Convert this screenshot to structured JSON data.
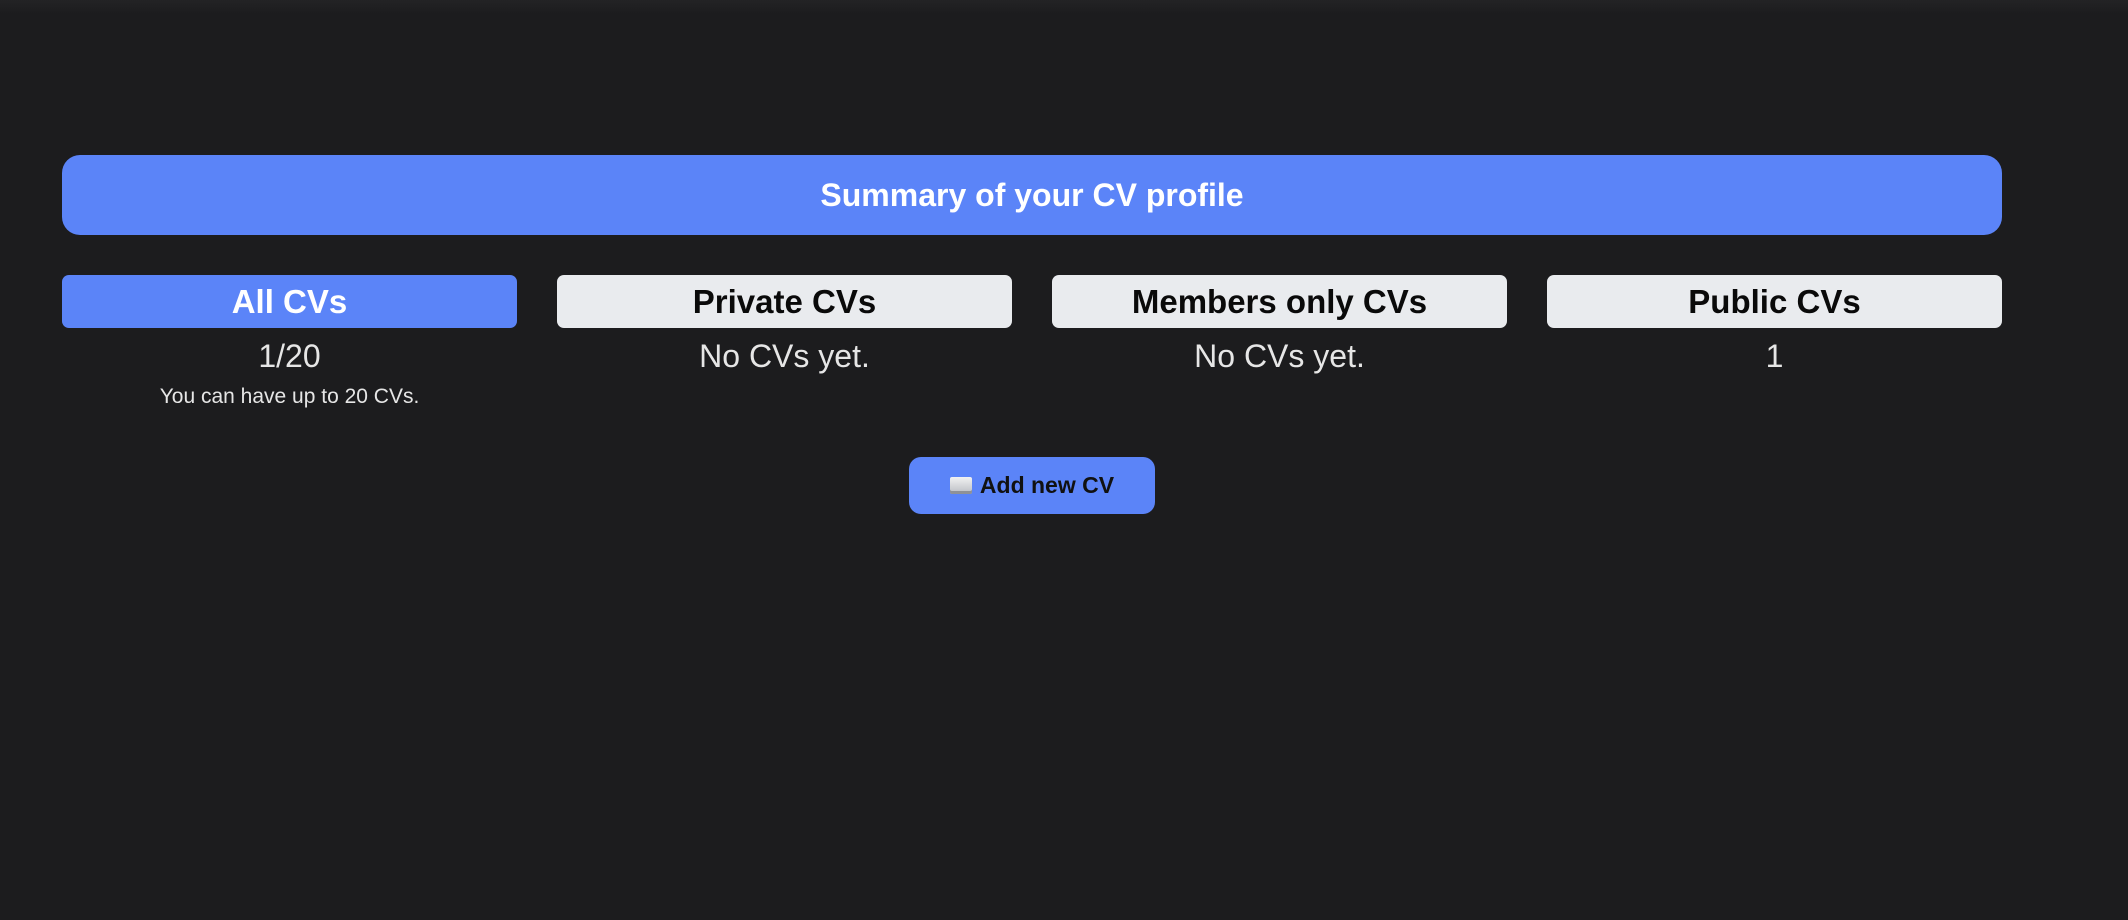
{
  "summary": {
    "title": "Summary of your CV profile"
  },
  "stats": [
    {
      "label": "All CVs",
      "value": "1/20",
      "hint": "You can have up to 20 CVs."
    },
    {
      "label": "Private CVs",
      "value": "No CVs yet."
    },
    {
      "label": "Members only CVs",
      "value": "No CVs yet."
    },
    {
      "label": "Public CVs",
      "value": "1"
    }
  ],
  "actions": {
    "add_icon": "laptop-icon",
    "add_label": "Add new CV"
  },
  "colors": {
    "background": "#1c1c1e",
    "accent": "#5b84f8",
    "tab_inactive": "#e9ebee",
    "text_light": "#e6e6e6"
  }
}
